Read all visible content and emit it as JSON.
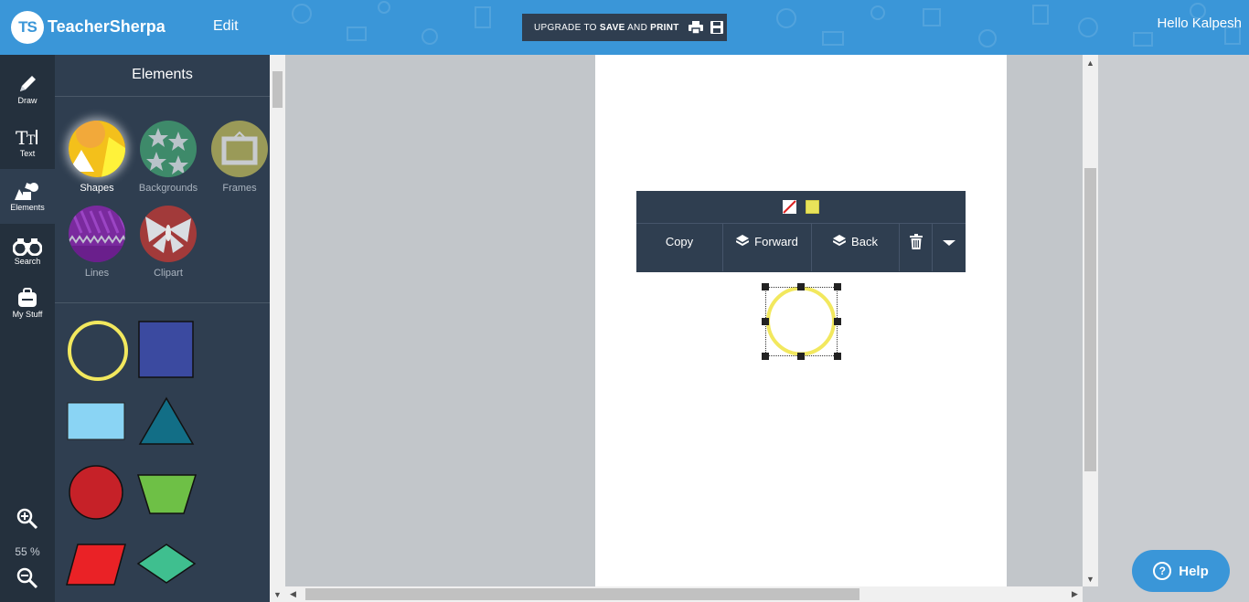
{
  "header": {
    "logo_mark": "TS",
    "brand": "TeacherSherpa",
    "edit_label": "Edit",
    "upgrade": {
      "prefix": "UPGRADE TO ",
      "save": "SAVE",
      "and": " AND ",
      "print": "PRINT"
    },
    "greeting": "Hello Kalpesh"
  },
  "rail": {
    "items": [
      {
        "label": "Draw",
        "icon": "pencil-icon"
      },
      {
        "label": "Text",
        "icon": "text-icon"
      },
      {
        "label": "Elements",
        "icon": "shapes-icon"
      },
      {
        "label": "Search",
        "icon": "binoculars-icon"
      },
      {
        "label": "My Stuff",
        "icon": "backpack-icon"
      }
    ],
    "zoom": "55 %"
  },
  "panel": {
    "title": "Elements",
    "categories": [
      {
        "label": "Shapes",
        "selected": true
      },
      {
        "label": "Backgrounds"
      },
      {
        "label": "Frames"
      },
      {
        "label": "Lines"
      },
      {
        "label": "Clipart"
      }
    ],
    "shapes": [
      {
        "name": "circle-outline",
        "color": "#f2e85e"
      },
      {
        "name": "square",
        "color": "#3b4aa0"
      },
      {
        "name": "rectangle",
        "color": "#8ad4f4"
      },
      {
        "name": "triangle",
        "color": "#126e86"
      },
      {
        "name": "circle",
        "color": "#c62128"
      },
      {
        "name": "trapezoid",
        "color": "#6ec046"
      },
      {
        "name": "parallelogram",
        "color": "#ea2226"
      },
      {
        "name": "diamond",
        "color": "#3fbf8f"
      }
    ]
  },
  "context_menu": {
    "swatches": [
      "none",
      "#e8e35a"
    ],
    "copy": "Copy",
    "forward": "Forward",
    "back": "Back"
  },
  "help": {
    "label": "Help"
  }
}
